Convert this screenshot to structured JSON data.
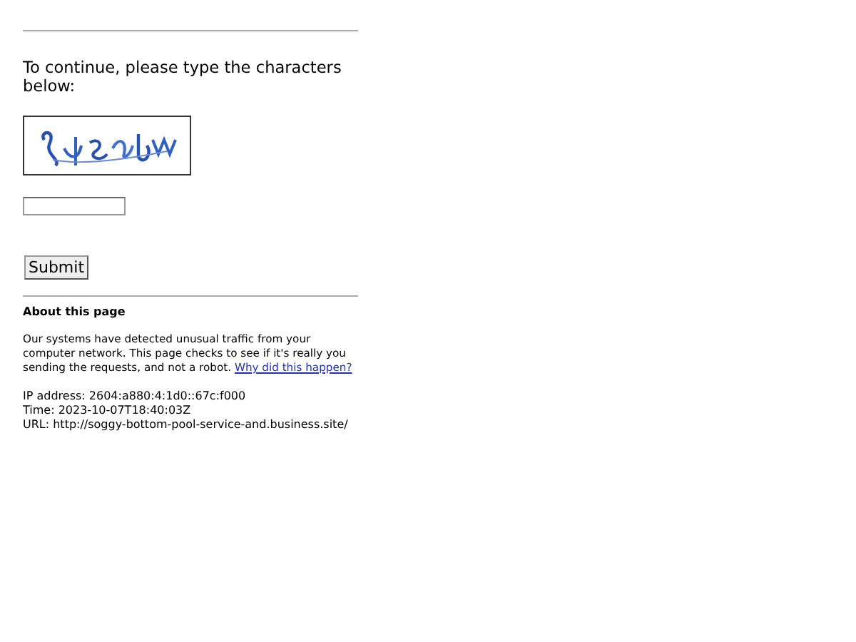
{
  "prompt": "To continue, please type the characters below:",
  "submit_button": "Submit",
  "about": {
    "heading": "About this page",
    "text": "Our systems have detected unusual traffic from your computer network. This page checks to see if it's really you sending the requests, and not a robot.",
    "link": "Why did this happen?"
  },
  "details": [
    "IP address: 2604:a880:4:1d0::67c:f000",
    "Time: 2023-10-07T18:40:03Z",
    "URL: http://soggy-bottom-pool-service-and.business.site/"
  ]
}
